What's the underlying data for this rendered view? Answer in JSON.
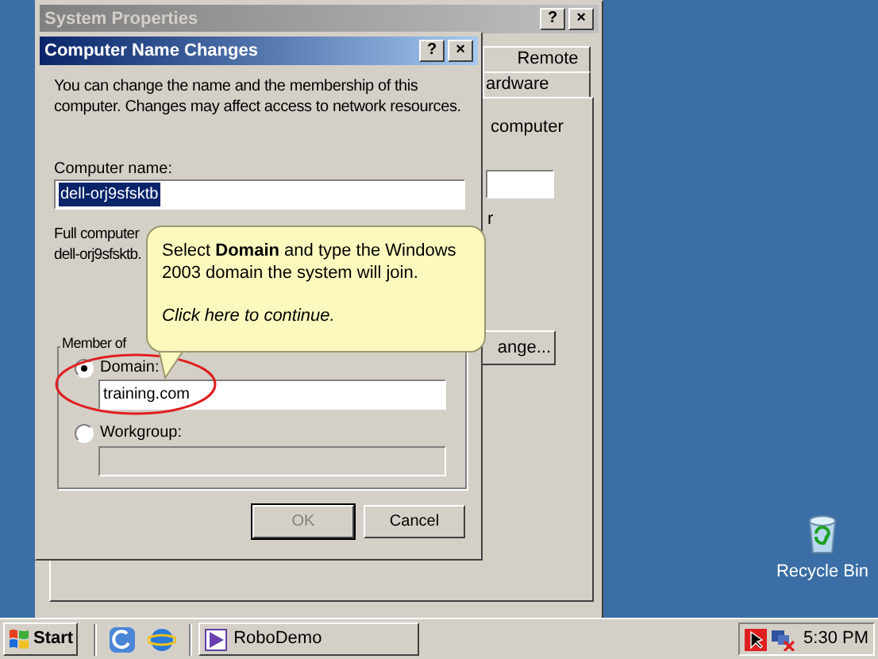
{
  "desktop": {
    "icons": [
      {
        "label": "Recycle Bin"
      }
    ]
  },
  "system_properties": {
    "title": "System Properties",
    "title_buttons": [
      "?",
      "×"
    ],
    "tabs": [
      {
        "label": "Remote",
        "selected": false
      },
      {
        "label": "ardware",
        "selected": false
      }
    ],
    "texts": [
      "computer",
      "r"
    ],
    "button": "ange..."
  },
  "dialog": {
    "title": "Computer Name Changes",
    "title_buttons": [
      "?",
      "×"
    ],
    "intro": "You can change the name and the membership of this computer. Changes may affect access to network resources.",
    "computer_name_label": "Computer name:",
    "computer_name": {
      "value": "dell-orj9sfsktb",
      "selected": true
    },
    "full_name_label": "Full computer",
    "full_name": "dell-orj9sfsktb.",
    "group_label": "Member of",
    "options": [
      {
        "label": "Domain:",
        "selected": true,
        "value": "training.com",
        "disabled": false
      },
      {
        "label": "Workgroup:",
        "selected": false,
        "disabled": true
      }
    ],
    "buttons": [
      {
        "label": "OK",
        "disabled": true
      },
      {
        "label": "Cancel",
        "disabled": false
      }
    ]
  },
  "callout": {
    "text": "Select **Domain** and type the Windows 2003 domain the system will join.",
    "action": "Click here to continue."
  },
  "taskbar": {
    "start": "Start",
    "tasks": [
      {
        "label": "RoboDemo",
        "selected": false
      }
    ],
    "clock": "5:30 PM"
  }
}
